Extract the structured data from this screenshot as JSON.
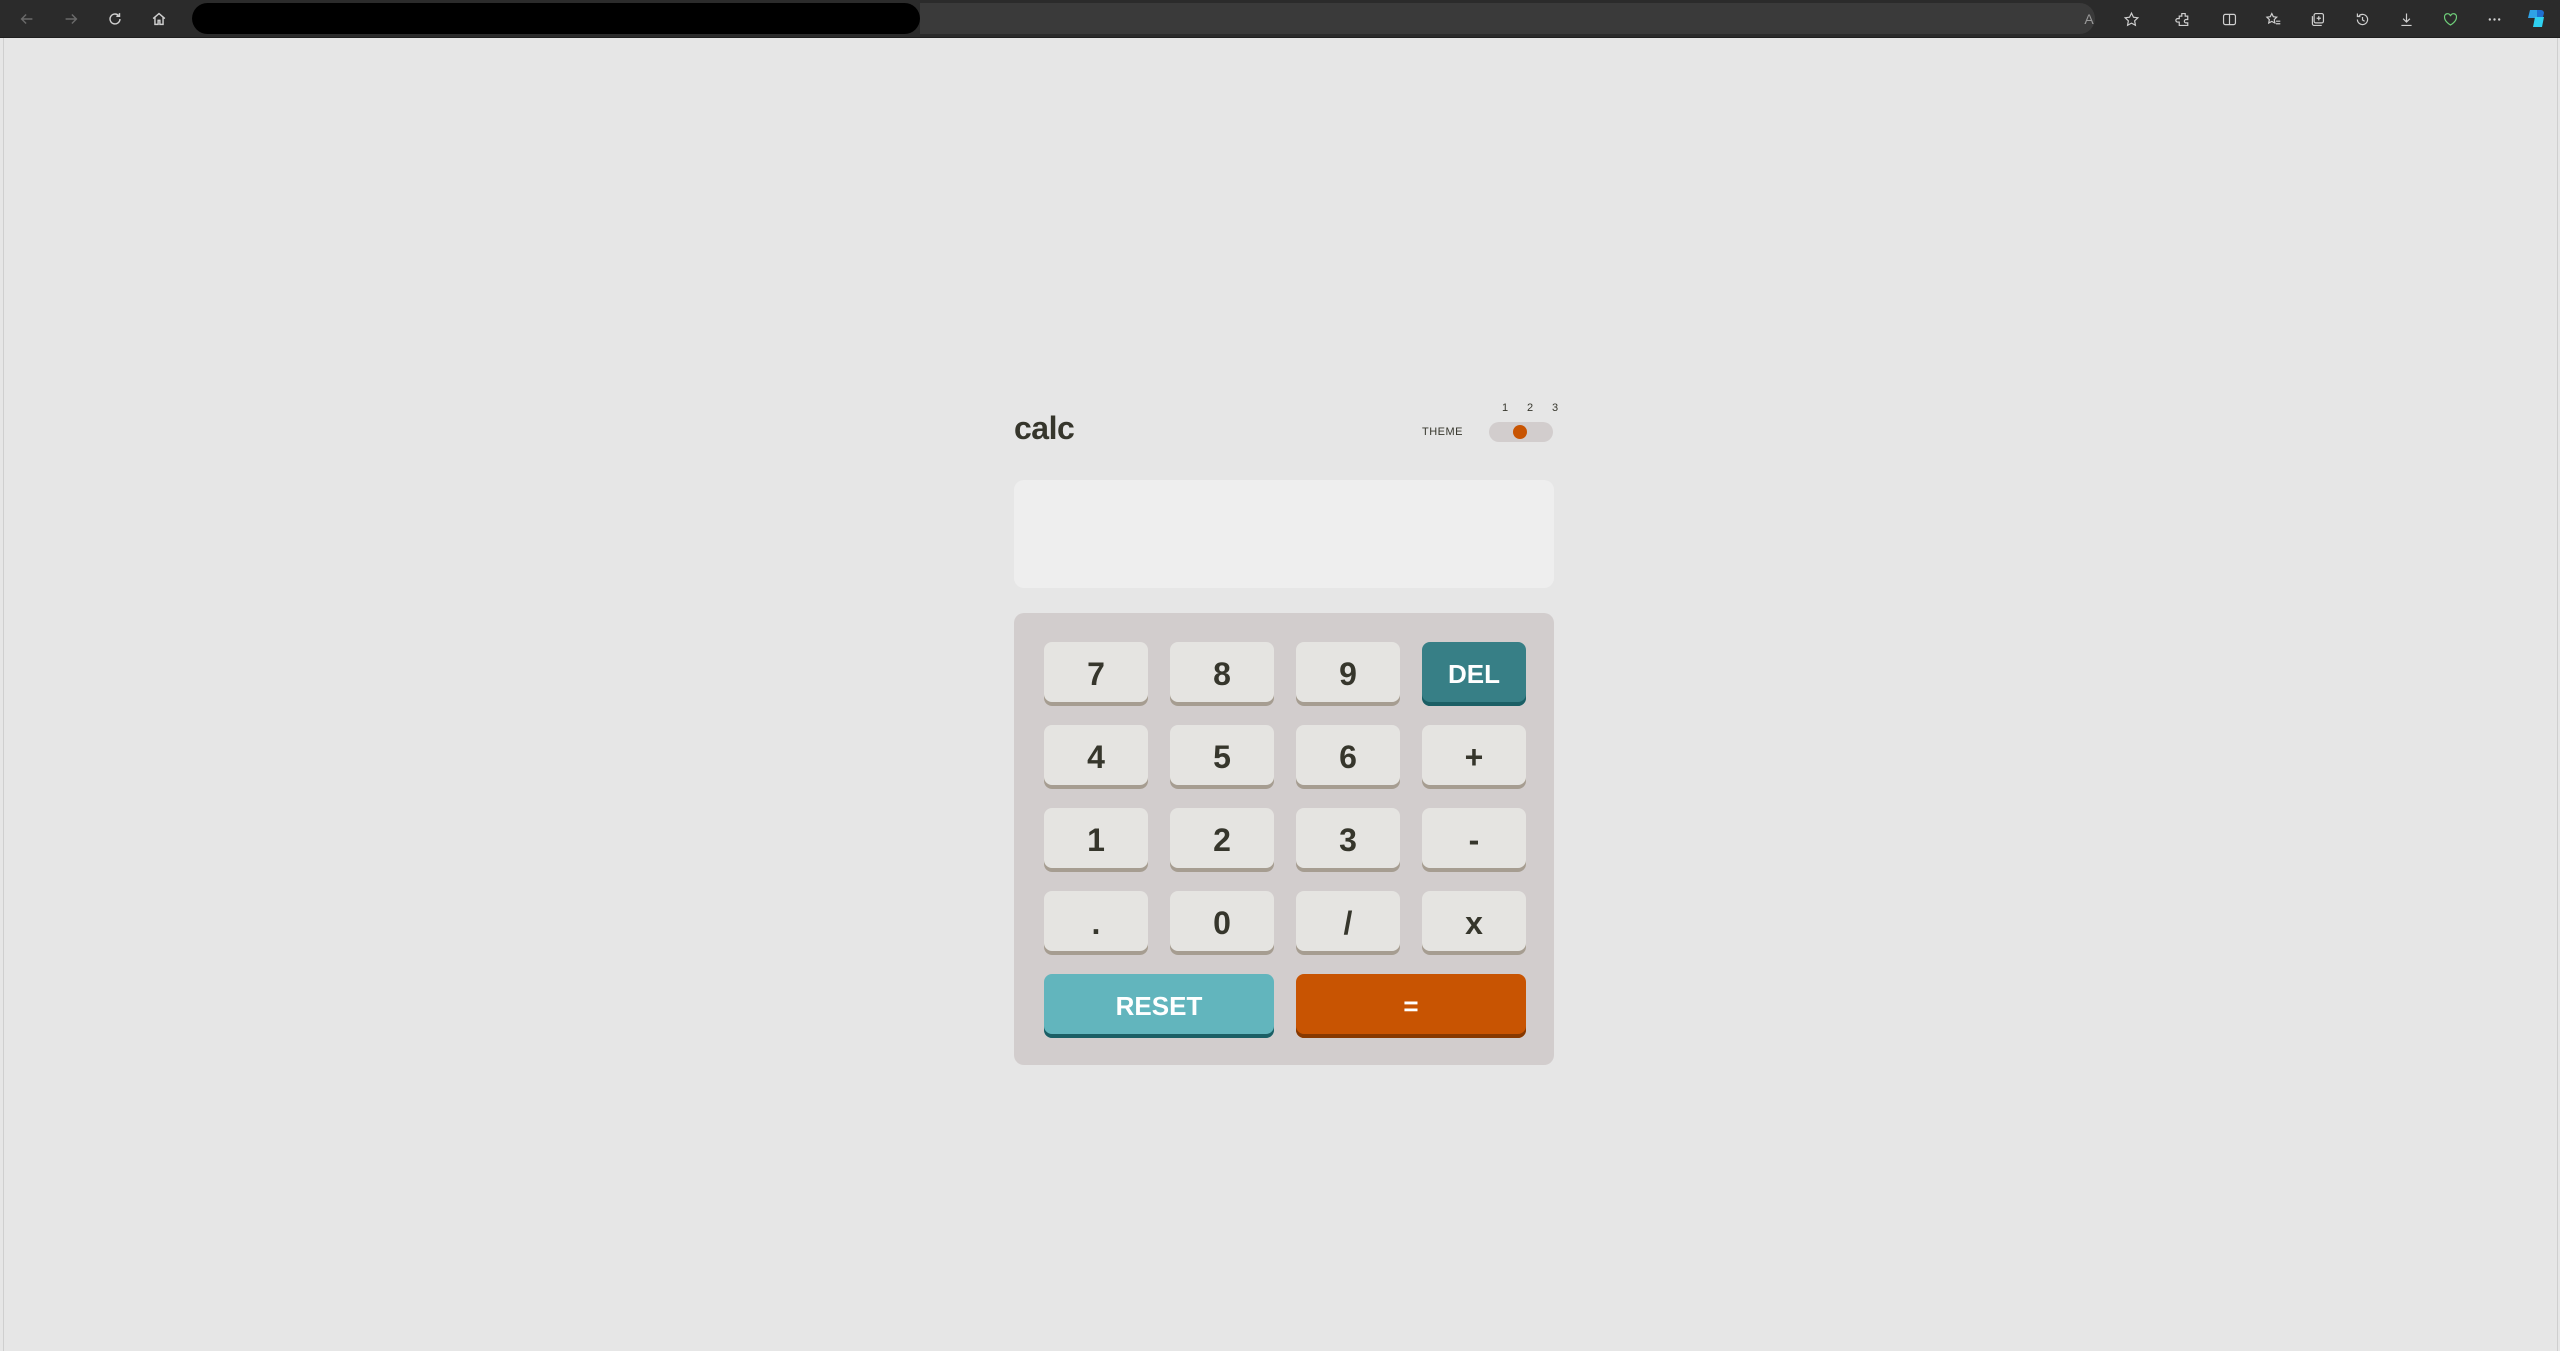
{
  "browser": {
    "aa_label": "A",
    "accent": "#2b2b2b"
  },
  "app": {
    "title": "calc",
    "theme_label": "THEME",
    "theme_options": [
      "1",
      "2",
      "3"
    ],
    "theme_selected": "2",
    "display_value": ""
  },
  "keypad": {
    "row1": [
      "7",
      "8",
      "9",
      "DEL"
    ],
    "row2": [
      "4",
      "5",
      "6",
      "+"
    ],
    "row3": [
      "1",
      "2",
      "3",
      "-"
    ],
    "row4": [
      ".",
      "0",
      "/",
      "x"
    ],
    "reset": "RESET",
    "equals": "="
  },
  "colors": {
    "background": "#e6e6e6",
    "keypad_bg": "#d2cdcd",
    "display_bg": "#eeeeee",
    "key_bg": "#e5e4e1",
    "del_key": "#377f86",
    "reset_key": "#62b5bd",
    "equals_key": "#c85402",
    "text": "#36362c"
  },
  "icons": {
    "back": "arrow-left-icon",
    "forward": "arrow-right-icon",
    "refresh": "refresh-icon",
    "home": "home-icon"
  }
}
